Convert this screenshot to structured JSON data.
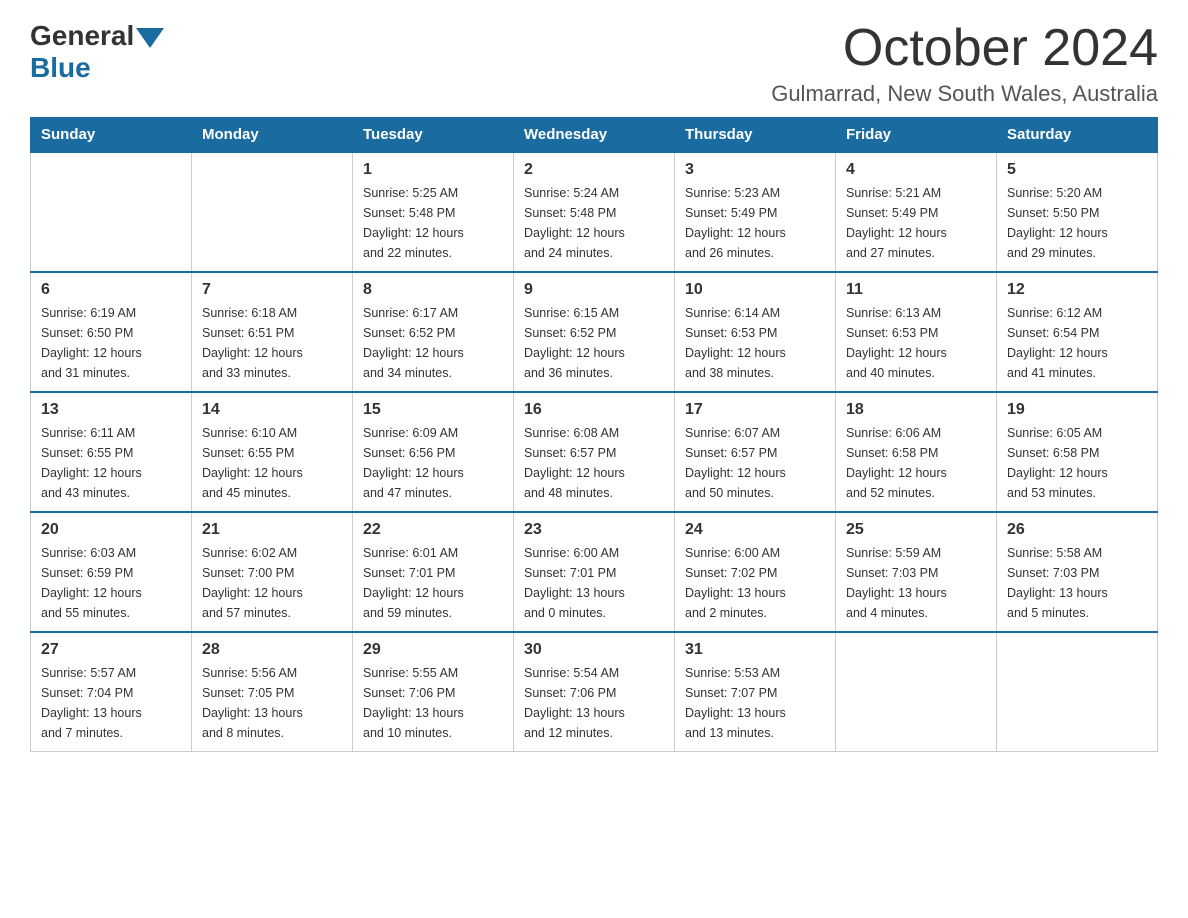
{
  "logo": {
    "general": "General",
    "blue": "Blue"
  },
  "title": "October 2024",
  "subtitle": "Gulmarrad, New South Wales, Australia",
  "header": {
    "days": [
      "Sunday",
      "Monday",
      "Tuesday",
      "Wednesday",
      "Thursday",
      "Friday",
      "Saturday"
    ]
  },
  "weeks": [
    [
      {
        "day": "",
        "info": ""
      },
      {
        "day": "",
        "info": ""
      },
      {
        "day": "1",
        "info": "Sunrise: 5:25 AM\nSunset: 5:48 PM\nDaylight: 12 hours\nand 22 minutes."
      },
      {
        "day": "2",
        "info": "Sunrise: 5:24 AM\nSunset: 5:48 PM\nDaylight: 12 hours\nand 24 minutes."
      },
      {
        "day": "3",
        "info": "Sunrise: 5:23 AM\nSunset: 5:49 PM\nDaylight: 12 hours\nand 26 minutes."
      },
      {
        "day": "4",
        "info": "Sunrise: 5:21 AM\nSunset: 5:49 PM\nDaylight: 12 hours\nand 27 minutes."
      },
      {
        "day": "5",
        "info": "Sunrise: 5:20 AM\nSunset: 5:50 PM\nDaylight: 12 hours\nand 29 minutes."
      }
    ],
    [
      {
        "day": "6",
        "info": "Sunrise: 6:19 AM\nSunset: 6:50 PM\nDaylight: 12 hours\nand 31 minutes."
      },
      {
        "day": "7",
        "info": "Sunrise: 6:18 AM\nSunset: 6:51 PM\nDaylight: 12 hours\nand 33 minutes."
      },
      {
        "day": "8",
        "info": "Sunrise: 6:17 AM\nSunset: 6:52 PM\nDaylight: 12 hours\nand 34 minutes."
      },
      {
        "day": "9",
        "info": "Sunrise: 6:15 AM\nSunset: 6:52 PM\nDaylight: 12 hours\nand 36 minutes."
      },
      {
        "day": "10",
        "info": "Sunrise: 6:14 AM\nSunset: 6:53 PM\nDaylight: 12 hours\nand 38 minutes."
      },
      {
        "day": "11",
        "info": "Sunrise: 6:13 AM\nSunset: 6:53 PM\nDaylight: 12 hours\nand 40 minutes."
      },
      {
        "day": "12",
        "info": "Sunrise: 6:12 AM\nSunset: 6:54 PM\nDaylight: 12 hours\nand 41 minutes."
      }
    ],
    [
      {
        "day": "13",
        "info": "Sunrise: 6:11 AM\nSunset: 6:55 PM\nDaylight: 12 hours\nand 43 minutes."
      },
      {
        "day": "14",
        "info": "Sunrise: 6:10 AM\nSunset: 6:55 PM\nDaylight: 12 hours\nand 45 minutes."
      },
      {
        "day": "15",
        "info": "Sunrise: 6:09 AM\nSunset: 6:56 PM\nDaylight: 12 hours\nand 47 minutes."
      },
      {
        "day": "16",
        "info": "Sunrise: 6:08 AM\nSunset: 6:57 PM\nDaylight: 12 hours\nand 48 minutes."
      },
      {
        "day": "17",
        "info": "Sunrise: 6:07 AM\nSunset: 6:57 PM\nDaylight: 12 hours\nand 50 minutes."
      },
      {
        "day": "18",
        "info": "Sunrise: 6:06 AM\nSunset: 6:58 PM\nDaylight: 12 hours\nand 52 minutes."
      },
      {
        "day": "19",
        "info": "Sunrise: 6:05 AM\nSunset: 6:58 PM\nDaylight: 12 hours\nand 53 minutes."
      }
    ],
    [
      {
        "day": "20",
        "info": "Sunrise: 6:03 AM\nSunset: 6:59 PM\nDaylight: 12 hours\nand 55 minutes."
      },
      {
        "day": "21",
        "info": "Sunrise: 6:02 AM\nSunset: 7:00 PM\nDaylight: 12 hours\nand 57 minutes."
      },
      {
        "day": "22",
        "info": "Sunrise: 6:01 AM\nSunset: 7:01 PM\nDaylight: 12 hours\nand 59 minutes."
      },
      {
        "day": "23",
        "info": "Sunrise: 6:00 AM\nSunset: 7:01 PM\nDaylight: 13 hours\nand 0 minutes."
      },
      {
        "day": "24",
        "info": "Sunrise: 6:00 AM\nSunset: 7:02 PM\nDaylight: 13 hours\nand 2 minutes."
      },
      {
        "day": "25",
        "info": "Sunrise: 5:59 AM\nSunset: 7:03 PM\nDaylight: 13 hours\nand 4 minutes."
      },
      {
        "day": "26",
        "info": "Sunrise: 5:58 AM\nSunset: 7:03 PM\nDaylight: 13 hours\nand 5 minutes."
      }
    ],
    [
      {
        "day": "27",
        "info": "Sunrise: 5:57 AM\nSunset: 7:04 PM\nDaylight: 13 hours\nand 7 minutes."
      },
      {
        "day": "28",
        "info": "Sunrise: 5:56 AM\nSunset: 7:05 PM\nDaylight: 13 hours\nand 8 minutes."
      },
      {
        "day": "29",
        "info": "Sunrise: 5:55 AM\nSunset: 7:06 PM\nDaylight: 13 hours\nand 10 minutes."
      },
      {
        "day": "30",
        "info": "Sunrise: 5:54 AM\nSunset: 7:06 PM\nDaylight: 13 hours\nand 12 minutes."
      },
      {
        "day": "31",
        "info": "Sunrise: 5:53 AM\nSunset: 7:07 PM\nDaylight: 13 hours\nand 13 minutes."
      },
      {
        "day": "",
        "info": ""
      },
      {
        "day": "",
        "info": ""
      }
    ]
  ]
}
